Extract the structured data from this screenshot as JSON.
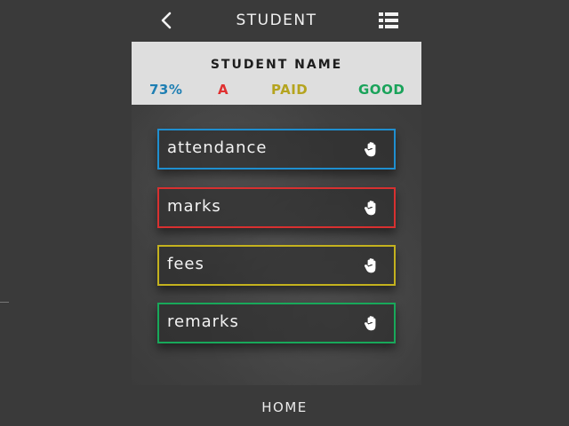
{
  "header": {
    "title": "STUDENT",
    "back_icon": "chevron-left-icon",
    "menu_icon": "list-icon"
  },
  "summary": {
    "student_name": "STUDENT NAME",
    "stats": [
      {
        "value": "73%",
        "color": "#1f7fb3"
      },
      {
        "value": "A",
        "color": "#e03030"
      },
      {
        "value": "PAID",
        "color": "#b5a41f"
      },
      {
        "value": "GOOD",
        "color": "#1aa35a"
      }
    ]
  },
  "cards": [
    {
      "label": "attendance",
      "color": "#1f8fd0",
      "icon": "hand-icon"
    },
    {
      "label": "marks",
      "color": "#d83030",
      "icon": "hand-icon"
    },
    {
      "label": "fees",
      "color": "#c4b21e",
      "icon": "hand-icon"
    },
    {
      "label": "remarks",
      "color": "#18a85a",
      "icon": "hand-icon"
    }
  ],
  "footer": {
    "home_label": "HOME"
  }
}
